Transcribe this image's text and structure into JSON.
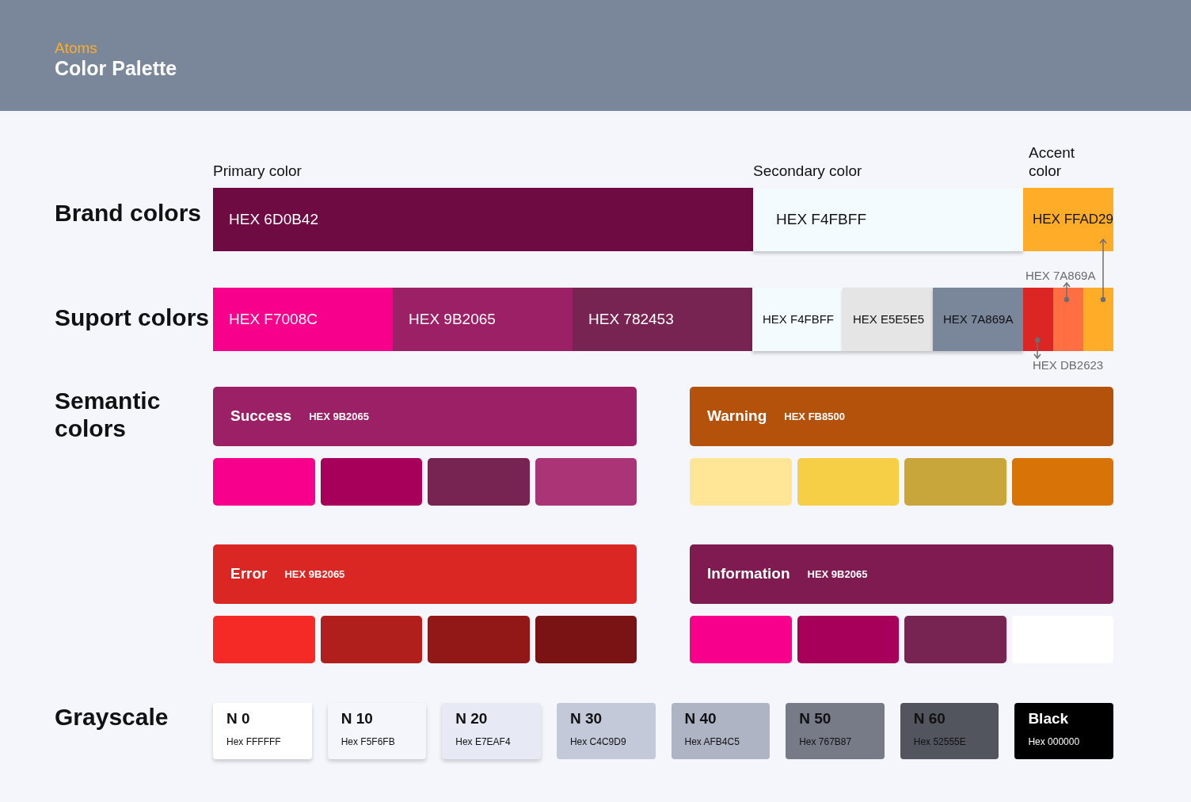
{
  "header": {
    "eyebrow": "Atoms",
    "title": "Color Palette"
  },
  "brand_colors": {
    "label": "Brand colors",
    "swatches": [
      {
        "kind": "primary",
        "heading": "Primary color",
        "hex": "HEX 6D0B42",
        "color": "#6d0b42"
      },
      {
        "kind": "secondary",
        "heading": "Secondary color",
        "hex": "HEX F4FBFF",
        "color": "#f4fbff"
      },
      {
        "kind": "accent",
        "heading": "Accent color",
        "hex": "HEX FFAD29",
        "color": "#ffad29"
      }
    ]
  },
  "support_colors": {
    "label": "Suport colors",
    "swatches": [
      {
        "kind": "wide",
        "hex": "HEX F7008C",
        "color": "#f7008c"
      },
      {
        "kind": "wide",
        "hex": "HEX 9B2065",
        "color": "#9b2065"
      },
      {
        "kind": "wide",
        "hex": "HEX 782453",
        "color": "#782453"
      },
      {
        "kind": "narrow",
        "hex": "HEX F4FBFF",
        "color": "#f4fbff"
      },
      {
        "kind": "narrow",
        "hex": "HEX E5E5E5",
        "color": "#e5e5e5"
      },
      {
        "kind": "narrow",
        "hex": "HEX 7A869A",
        "color": "#7a869a"
      },
      {
        "kind": "strip",
        "color": "#db2623"
      },
      {
        "kind": "strip",
        "color": "#ff6f43"
      },
      {
        "kind": "strip",
        "color": "#ffad29"
      }
    ],
    "annotations": [
      "HEX 7A869A",
      "HEX DB2623"
    ]
  },
  "semantic_colors": {
    "label": "Semantic colors",
    "groups": [
      {
        "name": "Success",
        "hex": "HEX 9B2065",
        "color": "#9b2065",
        "shades": [
          {
            "color": "#f7008c"
          },
          {
            "color": "#a7005b"
          },
          {
            "color": "#782453"
          },
          {
            "color": "#aa3475"
          }
        ]
      },
      {
        "name": "Warning",
        "hex": "HEX FB8500",
        "color": "#b4520b",
        "shades": [
          {
            "color": "#ffe697"
          },
          {
            "color": "#f7cf47"
          },
          {
            "color": "#c8a63b"
          },
          {
            "color": "#d87407"
          }
        ]
      },
      {
        "name": "Error",
        "hex": "HEX 9B2065",
        "color": "#da2723",
        "shades": [
          {
            "color": "#f52a26"
          },
          {
            "color": "#b01f1c"
          },
          {
            "color": "#911816"
          },
          {
            "color": "#7a1313"
          }
        ]
      },
      {
        "name": "Information",
        "hex": "HEX 9B2065",
        "color": "#7f1b51",
        "shades": [
          {
            "color": "#f7008c"
          },
          {
            "color": "#a7005b"
          },
          {
            "color": "#782453"
          },
          {
            "color": "#ffffff"
          }
        ]
      }
    ]
  },
  "grayscale": {
    "label": "Grayscale",
    "swatches": [
      {
        "name": "N 0",
        "hex": "Hex FFFFFF",
        "color": "#ffffff"
      },
      {
        "name": "N 10",
        "hex": "Hex F5F6FB",
        "color": "#f5f6fb"
      },
      {
        "name": "N 20",
        "hex": "Hex E7EAF4",
        "color": "#e7eaf4"
      },
      {
        "name": "N 30",
        "hex": "Hex C4C9D9",
        "color": "#c4c9d9"
      },
      {
        "name": "N 40",
        "hex": "Hex AFB4C5",
        "color": "#afb4c5"
      },
      {
        "name": "N 50",
        "hex": "Hex 767B87",
        "color": "#767b87"
      },
      {
        "name": "N 60",
        "hex": "Hex 52555E",
        "color": "#52555e"
      },
      {
        "name": "Black",
        "hex": "Hex 000000",
        "color": "#000000"
      }
    ]
  }
}
